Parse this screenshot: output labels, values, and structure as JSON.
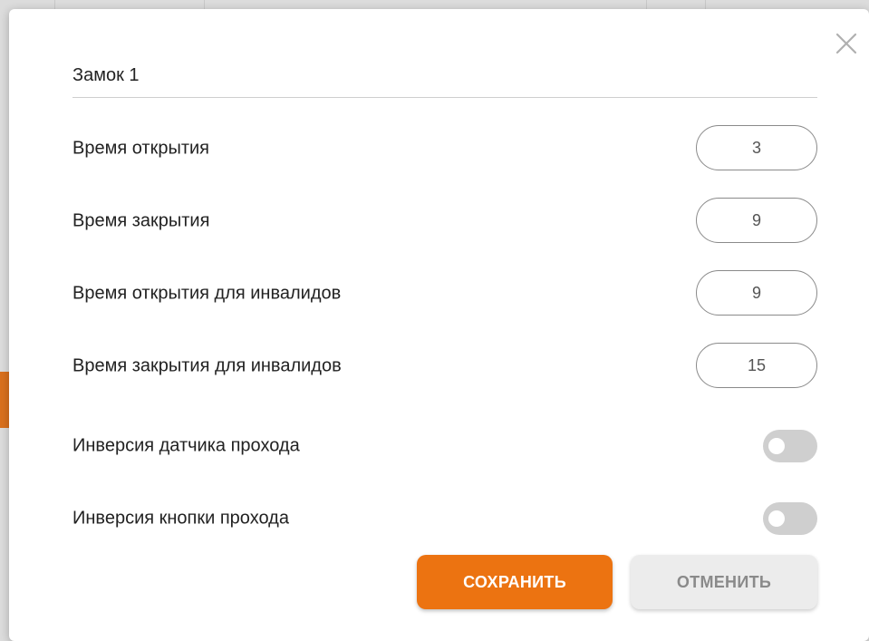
{
  "dialog": {
    "title": "Замок 1"
  },
  "fields": [
    {
      "label": "Время открытия",
      "value": "3"
    },
    {
      "label": "Время закрытия",
      "value": "9"
    },
    {
      "label": "Время открытия для инвалидов",
      "value": "9"
    },
    {
      "label": "Время закрытия для инвалидов",
      "value": "15"
    }
  ],
  "toggles": [
    {
      "label": "Инверсия датчика прохода",
      "on": false
    },
    {
      "label": "Инверсия кнопки прохода",
      "on": false
    }
  ],
  "buttons": {
    "save_label": "СОХРАНИТЬ",
    "cancel_label": "ОТМЕНИТЬ"
  },
  "colors": {
    "accent": "#ec7311",
    "toggle_off": "#cfcfcf",
    "cancel_bg": "#ececec"
  },
  "icons": {
    "close": "close-icon"
  }
}
